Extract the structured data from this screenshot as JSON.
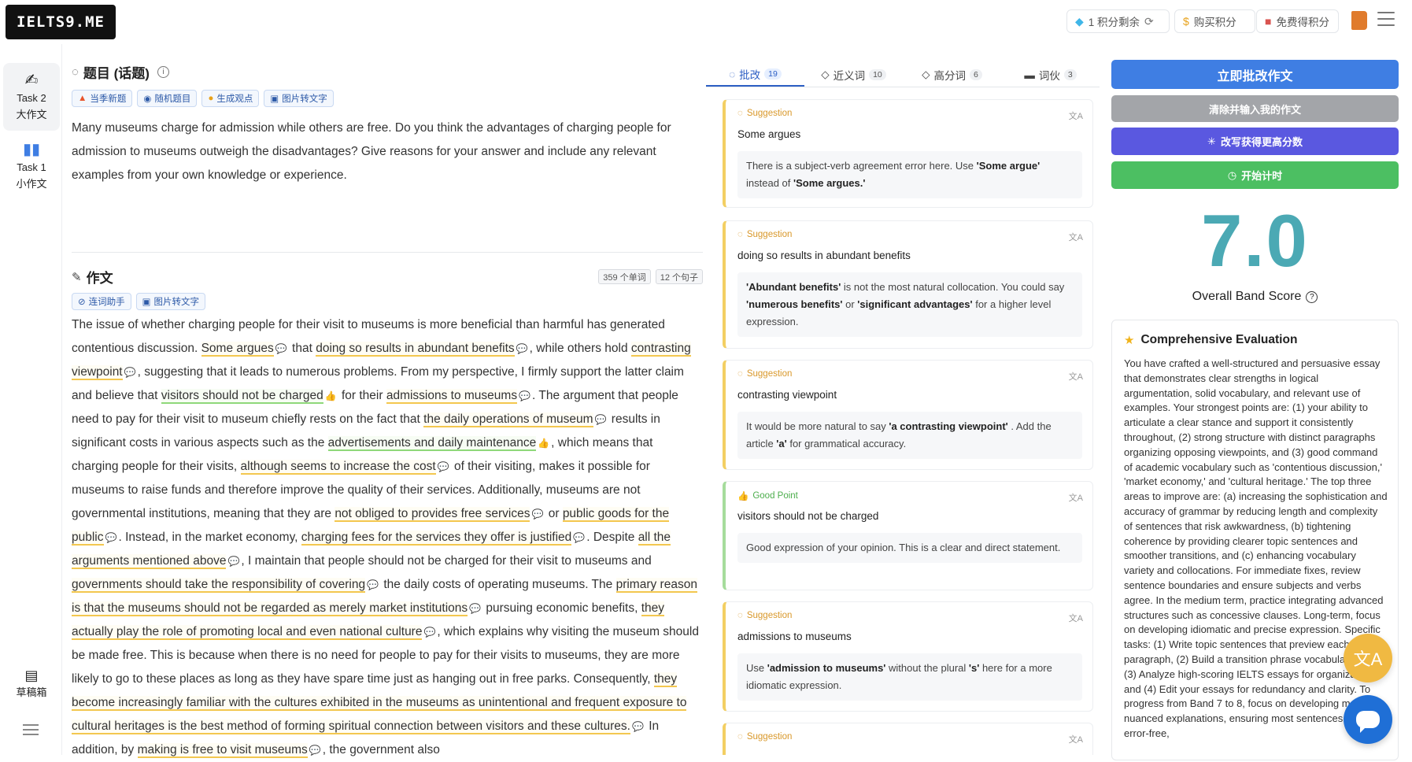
{
  "header": {
    "logo": "IELTS9.ME",
    "credits_label": "1 积分剩余",
    "buy_label": "购买积分",
    "free_label": "免费得积分"
  },
  "nav": {
    "task2_line1": "Task 2",
    "task2_line2": "大作文",
    "task1_line1": "Task 1",
    "task1_line2": "小作文",
    "drafts": "草稿箱"
  },
  "question": {
    "title": "题目 (话题)",
    "tags": [
      "当季新题",
      "随机题目",
      "生成观点",
      "图片转文字"
    ],
    "text": "Many museums charge for admission while others are free. Do you think the advantages of charging people for admission to museums outweigh the disadvantages? Give reasons for your answer and include any relevant examples from your own knowledge or experience."
  },
  "essay": {
    "title": "作文",
    "tools": [
      "连词助手",
      "图片转文字"
    ],
    "word_count": "359 个单词",
    "sentence_count": "12 个句子",
    "segments": [
      {
        "t": "The issue of whether charging people for their visit to museums is more beneficial than harmful has generated contentious discussion. "
      },
      {
        "t": "Some argues",
        "h": "s"
      },
      {
        "t": " that "
      },
      {
        "t": "doing so results in abundant benefits",
        "h": "s"
      },
      {
        "t": ", while others hold "
      },
      {
        "t": "contrasting viewpoint",
        "h": "s"
      },
      {
        "t": ", suggesting that it leads to numerous problems. From my perspective, I firmly support the latter claim and believe that "
      },
      {
        "t": "visitors should not be charged",
        "h": "g"
      },
      {
        "t": " for their "
      },
      {
        "t": "admissions to museums",
        "h": "s"
      },
      {
        "t": ". The argument that people need to pay for their visit to museum chiefly rests on the fact that "
      },
      {
        "t": "the daily operations of museum",
        "h": "s"
      },
      {
        "t": " results in significant costs in various aspects such as the "
      },
      {
        "t": "advertisements and daily maintenance",
        "h": "g"
      },
      {
        "t": ", which means that charging people for their visits, "
      },
      {
        "t": "although seems to increase the cost",
        "h": "s"
      },
      {
        "t": " of their visiting, makes it possible for museums to raise funds and therefore improve the quality of their services. Additionally, museums are not governmental institutions, meaning that they are "
      },
      {
        "t": "not obliged to provides free services",
        "h": "s"
      },
      {
        "t": " or "
      },
      {
        "t": "public goods for the public",
        "h": "s"
      },
      {
        "t": ". Instead, in the market economy, "
      },
      {
        "t": "charging fees for the services they offer is justified",
        "h": "s"
      },
      {
        "t": ". Despite "
      },
      {
        "t": "all the arguments mentioned above",
        "h": "s"
      },
      {
        "t": ", I maintain that people should not be charged for their visit to museums and "
      },
      {
        "t": "governments should take the responsibility of covering",
        "h": "s"
      },
      {
        "t": " the daily costs of operating museums. The "
      },
      {
        "t": "primary reason is that the museums should not be regarded as merely market institutions",
        "h": "s"
      },
      {
        "t": " pursuing economic benefits, "
      },
      {
        "t": "they actually play the role of promoting local and even national culture",
        "h": "s"
      },
      {
        "t": ", which explains why visiting the museum should be made free. This is because when there is no need for people to pay for their visits to museums, they are more likely to go to these places as long as they have spare time just as hanging out in free parks. Consequently, "
      },
      {
        "t": "they become increasingly familiar with the cultures exhibited in the museums as unintentional and frequent exposure to cultural heritages is the best method of forming spiritual connection between visitors and these cultures.",
        "h": "s"
      },
      {
        "t": " In addition, by "
      },
      {
        "t": "making is free to visit museums",
        "h": "s"
      },
      {
        "t": ", the government also"
      }
    ]
  },
  "feedback": {
    "tabs": [
      {
        "label": "批改",
        "count": "19"
      },
      {
        "label": "近义词",
        "count": "10"
      },
      {
        "label": "高分词",
        "count": "6"
      },
      {
        "label": "词伙",
        "count": "3"
      }
    ],
    "cards": [
      {
        "type": "Suggestion",
        "phrase": "Some argues",
        "parts": [
          {
            "t": "There is a subject-verb agreement error here. Use "
          },
          {
            "b": "'Some argue'"
          },
          {
            "t": " instead of "
          },
          {
            "b": "'Some argues.'"
          }
        ]
      },
      {
        "type": "Suggestion",
        "phrase": "doing so results in abundant benefits",
        "parts": [
          {
            "b": "'Abundant benefits'"
          },
          {
            "t": " is not the most natural collocation. You could say "
          },
          {
            "b": "'numerous benefits'"
          },
          {
            "t": " or "
          },
          {
            "b": "'significant advantages'"
          },
          {
            "t": " for a higher level expression."
          }
        ]
      },
      {
        "type": "Suggestion",
        "phrase": "contrasting viewpoint",
        "parts": [
          {
            "t": "It would be more natural to say "
          },
          {
            "b": "'a contrasting viewpoint'"
          },
          {
            "t": ". Add the article "
          },
          {
            "b": "'a'"
          },
          {
            "t": " for grammatical accuracy."
          }
        ]
      },
      {
        "type": "Good Point",
        "phrase": "visitors should not be charged",
        "parts": [
          {
            "t": "Good expression of your opinion. This is a clear and direct statement."
          }
        ]
      },
      {
        "type": "Suggestion",
        "phrase": "admissions to museums",
        "parts": [
          {
            "t": "Use "
          },
          {
            "b": "'admission to museums'"
          },
          {
            "t": " without the plural "
          },
          {
            "b": "'s'"
          },
          {
            "t": " here for a more idiomatic expression."
          }
        ]
      },
      {
        "type": "Suggestion",
        "phrase": "",
        "parts": []
      }
    ]
  },
  "actions": {
    "submit": "立即批改作文",
    "clear": "清除并输入我的作文",
    "rewrite": "改写获得更高分数",
    "timer": "开始计时"
  },
  "score": {
    "value": "7.0",
    "label": "Overall Band Score"
  },
  "evaluation": {
    "title": "Comprehensive Evaluation",
    "text": "You have crafted a well-structured and persuasive essay that demonstrates clear strengths in logical argumentation, solid vocabulary, and relevant use of examples. Your strongest points are: (1) your ability to articulate a clear stance and support it consistently throughout, (2) strong structure with distinct paragraphs organizing opposing viewpoints, and (3) good command of academic vocabulary such as 'contentious discussion,' 'market economy,' and 'cultural heritage.' The top three areas to improve are: (a) increasing the sophistication and accuracy of grammar by reducing length and complexity of sentences that risk awkwardness, (b) tightening coherence by providing clearer topic sentences and smoother transitions, and (c) enhancing vocabulary variety and collocations. For immediate fixes, review sentence boundaries and ensure subjects and verbs agree. In the medium term, practice integrating advanced structures such as concessive clauses. Long-term, focus on developing idiomatic and precise expression. Specific tasks: (1) Write topic sentences that preview each paragraph, (2) Build a transition phrase vocabulary bank, (3) Analyze high-scoring IELTS essays for organization, and (4) Edit your essays for redundancy and clarity. To progress from Band 7 to 8, focus on developing more nuanced explanations, ensuring most sentences are error-free,"
  },
  "colors": {
    "primary": "#3f7ee3",
    "score": "#4ba9b4",
    "suggestion": "#f3c74f",
    "good": "#8fd87a"
  }
}
